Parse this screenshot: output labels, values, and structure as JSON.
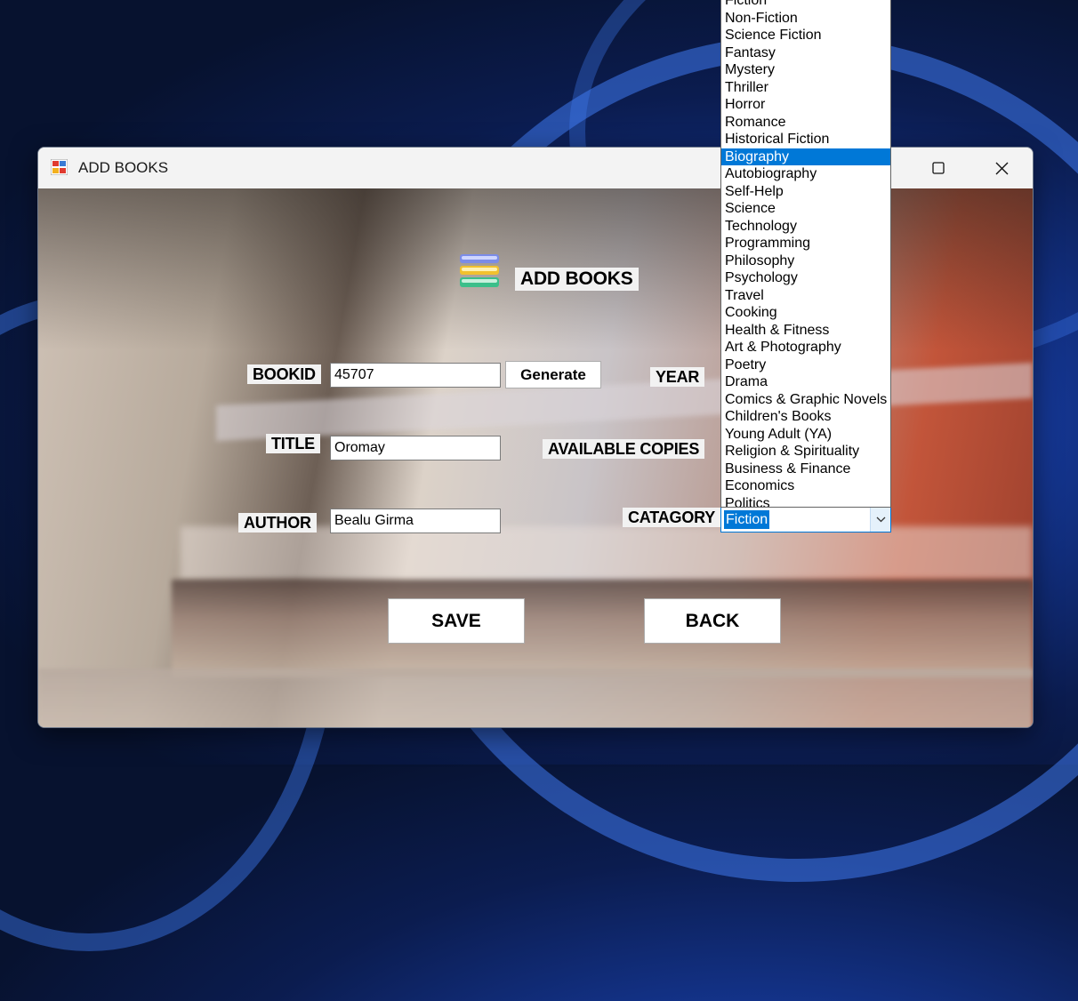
{
  "window": {
    "title": "ADD BOOKS"
  },
  "header": {
    "title": "ADD BOOKS"
  },
  "form": {
    "bookid_label": "BOOKID",
    "bookid_value": "45707",
    "generate_label": "Generate",
    "title_label": "TITLE",
    "title_value": "Oromay",
    "author_label": "AUTHOR",
    "author_value": "Bealu Girma",
    "year_label": "YEAR",
    "copies_label": "AVAILABLE COPIES",
    "category_label": "CATAGORY",
    "category_selected": "Fiction"
  },
  "buttons": {
    "save": "SAVE",
    "back": "BACK"
  },
  "dropdown": {
    "items": [
      "Fiction",
      "Non-Fiction",
      "Science Fiction",
      "Fantasy",
      "Mystery",
      "Thriller",
      "Horror",
      "Romance",
      "Historical Fiction",
      "Biography",
      "Autobiography",
      "Self-Help",
      "Science",
      "Technology",
      "Programming",
      "Philosophy",
      "Psychology",
      "Travel",
      "Cooking",
      "Health & Fitness",
      "Art & Photography",
      "Poetry",
      "Drama",
      "Comics & Graphic Novels",
      "Children's Books",
      "Young Adult (YA)",
      "Religion & Spirituality",
      "Business & Finance",
      "Economics",
      "Politics"
    ],
    "highlighted": "Biography"
  },
  "colors": {
    "accent": "#0078d7",
    "desktop_background": "#0b1c4f"
  },
  "icons": {
    "app": "app-icon",
    "books": "books-stack-icon",
    "maximize": "maximize-icon",
    "close": "close-icon",
    "dropdown_arrow": "chevron-down-icon"
  }
}
